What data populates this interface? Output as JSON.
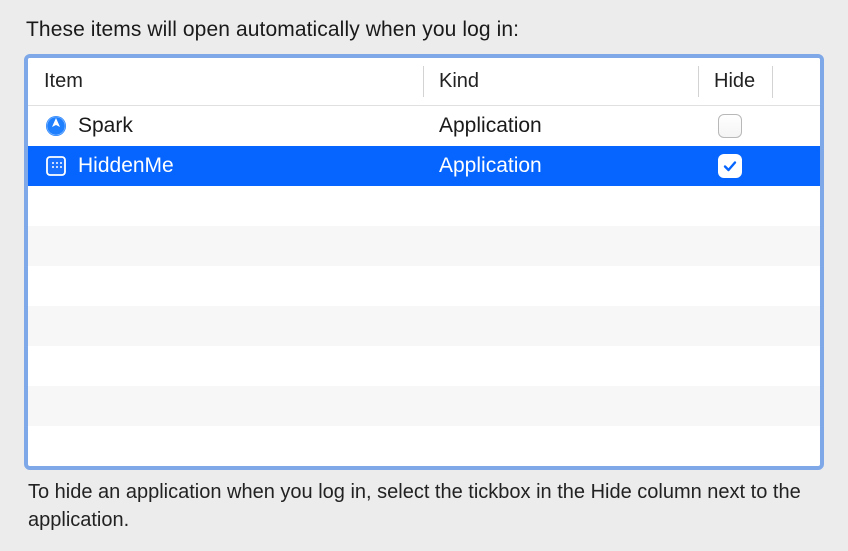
{
  "intro_text": "These items will open automatically when you log in:",
  "columns": {
    "item": "Item",
    "kind": "Kind",
    "hide": "Hide"
  },
  "rows": [
    {
      "name": "Spark",
      "kind": "Application",
      "hidden": false,
      "selected": false,
      "icon": "spark"
    },
    {
      "name": "HiddenMe",
      "kind": "Application",
      "hidden": true,
      "selected": true,
      "icon": "hiddenme"
    }
  ],
  "empty_row_count": 7,
  "caption_text": "To hide an application when you log in, select the tickbox in the Hide column next to the application."
}
